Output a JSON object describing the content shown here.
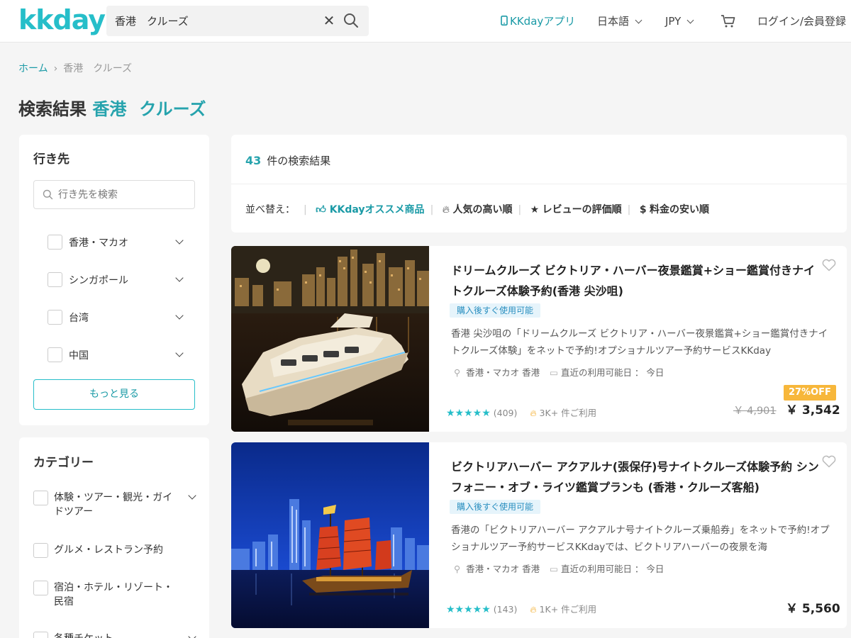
{
  "header": {
    "logo": "kkday",
    "search_value": "香港　クルーズ",
    "app_link": "KKdayアプリ",
    "language": "日本語",
    "currency": "JPY",
    "login": "ログイン/会員登録"
  },
  "breadcrumb": {
    "home": "ホーム",
    "items": [
      "香港",
      "クルーズ"
    ]
  },
  "title": {
    "prefix": "検索結果",
    "location": "香港",
    "keyword": "クルーズ"
  },
  "destination_filter": {
    "title": "行き先",
    "search_placeholder": "行き先を検索",
    "items": [
      "香港・マカオ",
      "シンガポール",
      "台湾",
      "中国"
    ],
    "more_button": "もっと見る"
  },
  "category_filter": {
    "title": "カテゴリー",
    "items": [
      "体験・ツアー・観光・ガイドツアー",
      "グルメ・レストラン予約",
      "宿泊・ホテル・リゾート・民宿",
      "各種チケット"
    ]
  },
  "results": {
    "count": "43",
    "count_label": "件の検索結果",
    "sort_label": "並べ替え：",
    "sort_options": [
      "KKdayオススメ商品",
      "人気の高い順",
      "レビューの評価順",
      "料金の安い順"
    ]
  },
  "products": [
    {
      "title": "ドリームクルーズ ビクトリア・ハーバー夜景鑑賞+ショー鑑賞付きナイトクルーズ体験予約(香港 尖沙咀)",
      "badge": "購入後すぐ使用可能",
      "description": "香港 尖沙咀の「ドリームクルーズ ビクトリア・ハーバー夜景鑑賞+ショー鑑賞付きナイトクルーズ体験」をネットで予約!オプショナルツアー予約サービスKKday",
      "location": "香港・マカオ 香港",
      "availability": "直近の利用可能日 ： 今日",
      "stars": "★★★★★",
      "rating": 4.5,
      "reviews": "(409)",
      "booked": "3K+ 件ご利用",
      "discount": "27%OFF",
      "old_price": "￥ 4,901",
      "price": "￥ 3,542"
    },
    {
      "title": "ビクトリアハーバー アクアルナ(張保仔)号ナイトクルーズ体験予約 シンフォニー・オブ・ライツ鑑賞プランも (香港・クルーズ客船)",
      "badge": "購入後すぐ使用可能",
      "description": "香港の「ビクトリアハーバー アクアルナ号ナイトクルーズ乗船券」をネットで予約!オプショナルツアー予約サービスKKdayでは、ビクトリアハーバーの夜景を海",
      "location": "香港・マカオ 香港",
      "availability": "直近の利用可能日 ： 今日",
      "stars": "★★★★★",
      "rating": 5,
      "reviews": "(143)",
      "booked": "1K+ 件ご利用",
      "price": "￥ 5,560"
    }
  ],
  "colors": {
    "brand": "#26bec9",
    "link": "#1a9aa6",
    "discount": "#f7b73b",
    "badge_bg": "#e6f4fb"
  }
}
